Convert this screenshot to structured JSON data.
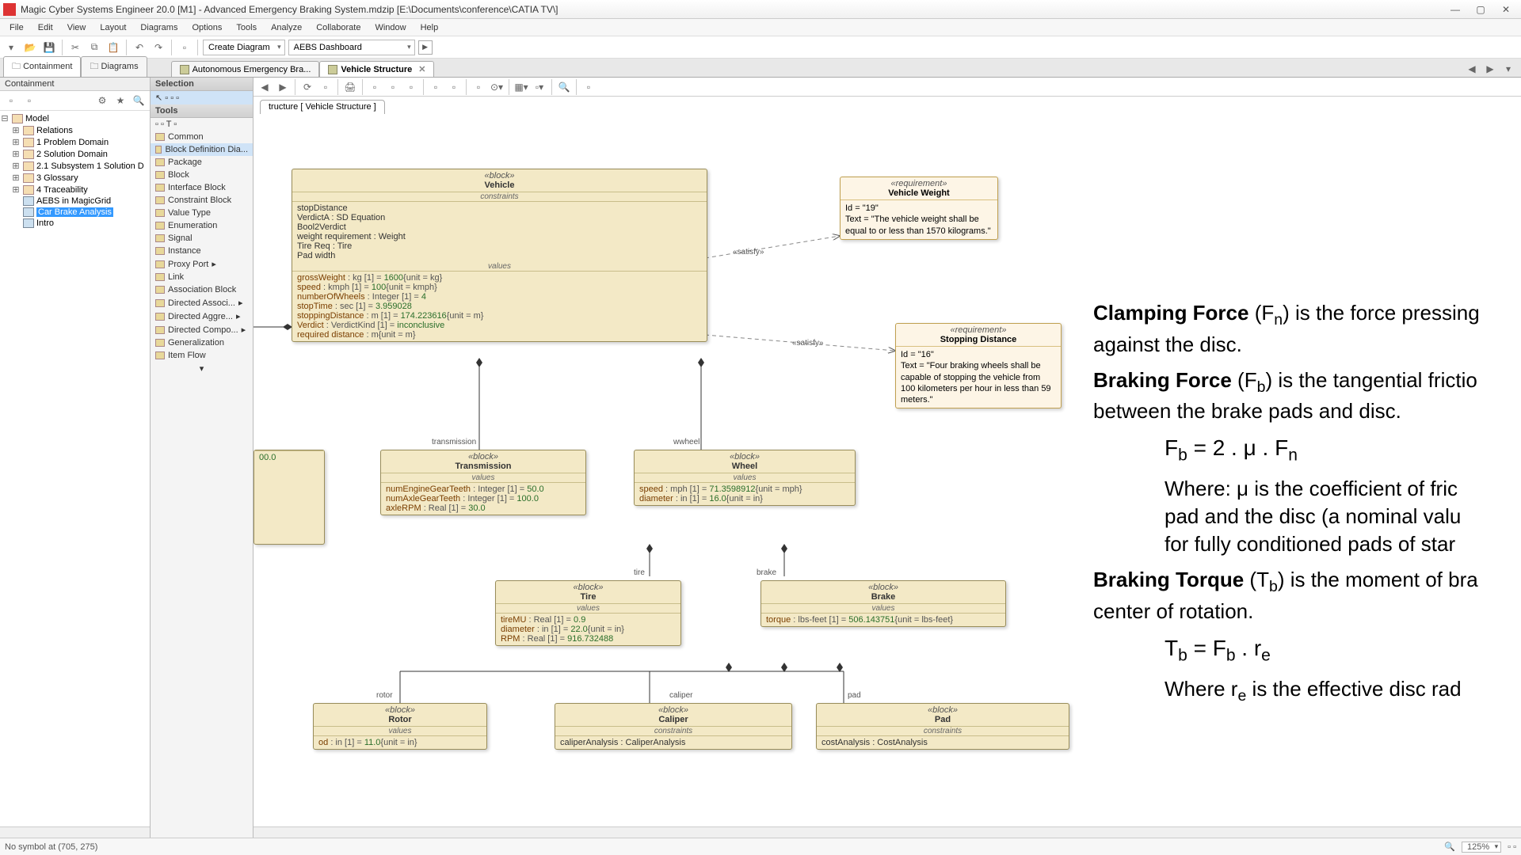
{
  "window": {
    "title": "Magic Cyber Systems Engineer 20.0 [M1] - Advanced Emergency Braking System.mdzip [E:\\Documents\\conference\\CATIA TV\\]",
    "minimize": "—",
    "maximize": "▢",
    "close": "✕"
  },
  "menu": [
    "File",
    "Edit",
    "View",
    "Layout",
    "Diagrams",
    "Options",
    "Tools",
    "Analyze",
    "Collaborate",
    "Window",
    "Help"
  ],
  "toolbar": {
    "create_diagram": "Create Diagram",
    "dashboard": "AEBS Dashboard"
  },
  "side_tabs": {
    "containment": "Containment",
    "diagrams": "Diagrams"
  },
  "doctabs": {
    "tab1": "Autonomous Emergency Bra...",
    "tab2": "Vehicle Structure"
  },
  "containment_panel": {
    "title": "Containment",
    "tree": {
      "root": "Model",
      "relations": "Relations",
      "problem": "1 Problem Domain",
      "solution": "2 Solution Domain",
      "subsystem": "2.1 Subsystem 1 Solution D",
      "glossary": "3 Glossary",
      "traceability": "4 Traceability",
      "aebs": "AEBS in MagicGrid",
      "car_brake": "Car Brake Analysis",
      "intro": "Intro"
    }
  },
  "palette": {
    "selection_head": "Selection",
    "tools_head": "Tools",
    "common": "Common",
    "bdd": "Block Definition Dia...",
    "package": "Package",
    "block": "Block",
    "interface": "Interface Block",
    "constraint": "Constraint Block",
    "valuetype": "Value Type",
    "enumeration": "Enumeration",
    "signal": "Signal",
    "instance": "Instance",
    "proxyport": "Proxy Port",
    "link": "Link",
    "assocblock": "Association Block",
    "dirassoc": "Directed Associ...",
    "diraggre": "Directed Aggre...",
    "dircompo": "Directed Compo...",
    "generalization": "Generalization",
    "itemflow": "Item Flow"
  },
  "breadcrumb": "tructure [ Vehicle Structure ]",
  "diagram": {
    "vehicle": {
      "stereo": "«block»",
      "name": "Vehicle",
      "sec_constraints": "constraints",
      "c1": "stopDistance",
      "c2": "VerdictA : SD Equation",
      "c3": "Bool2Verdict",
      "c4": "weight requirement : Weight",
      "c5": "Tire Req : Tire",
      "c6": "Pad width",
      "sec_values": "values",
      "v1_k": "grossWeight",
      "v1_t": ": kg [1] = ",
      "v1_v": "1600",
      "v1_u": "{unit = kg}",
      "v2_k": "speed",
      "v2_t": ": kmph [1] = ",
      "v2_v": "100",
      "v2_u": "{unit = kmph}",
      "v3_k": "numberOfWheels",
      "v3_t": ": Integer [1] = ",
      "v3_v": "4",
      "v4_k": "stopTime",
      "v4_t": ": sec [1] = ",
      "v4_v": "3.959028",
      "v5_k": "stoppingDistance",
      "v5_t": ": m [1] = ",
      "v5_v": "174.223616",
      "v5_u": "{unit = m}",
      "v6_k": "Verdict",
      "v6_t": ": VerdictKind [1] = ",
      "v6_v": "inconclusive",
      "v7_k": "required distance",
      "v7_t": ": m{unit = m}"
    },
    "req_weight": {
      "stereo": "«requirement»",
      "name": "Vehicle Weight",
      "id": "Id = \"19\"",
      "text": "Text = \"The vehicle weight shall be equal to or less than 1570 kilograms.\""
    },
    "req_stop": {
      "stereo": "«requirement»",
      "name": "Stopping Distance",
      "id": "Id = \"16\"",
      "text": "Text = \"Four braking wheels shall be capable of stopping the vehicle from 100 kilometers per hour in less than 59 meters.\""
    },
    "transmission": {
      "stereo": "«block»",
      "name": "Transmission",
      "sec": "values",
      "l1_k": "numEngineGearTeeth",
      "l1_t": ": Integer [1] = ",
      "l1_v": "50.0",
      "l2_k": "numAxleGearTeeth",
      "l2_t": ": Integer [1] = ",
      "l2_v": "100.0",
      "l3_k": "axleRPM",
      "l3_t": ": Real [1] = ",
      "l3_v": "30.0"
    },
    "wheel": {
      "stereo": "«block»",
      "name": "Wheel",
      "sec": "values",
      "l1_k": "speed",
      "l1_t": ": mph [1] = ",
      "l1_v": "71.3598912",
      "l1_u": "{unit = mph}",
      "l2_k": "diameter",
      "l2_t": ": in [1] = ",
      "l2_v": "16.0",
      "l2_u": "{unit = in}"
    },
    "tire": {
      "stereo": "«block»",
      "name": "Tire",
      "sec": "values",
      "l1_k": "tireMU",
      "l1_t": ": Real [1] = ",
      "l1_v": "0.9",
      "l2_k": "diameter",
      "l2_t": ": in [1] = ",
      "l2_v": "22.0",
      "l2_u": "{unit = in}",
      "l3_k": "RPM",
      "l3_t": ": Real [1] = ",
      "l3_v": "916.732488"
    },
    "brake": {
      "stereo": "«block»",
      "name": "Brake",
      "sec": "values",
      "l1_k": "torque",
      "l1_t": ": lbs-feet [1] = ",
      "l1_v": "506.143751",
      "l1_u": "{unit = lbs-feet}"
    },
    "rotor": {
      "stereo": "«block»",
      "name": "Rotor",
      "sec": "values",
      "l1_k": "od",
      "l1_t": ": in [1] = ",
      "l1_v": "11.0",
      "l1_u": "{unit = in}"
    },
    "caliper": {
      "stereo": "«block»",
      "name": "Caliper",
      "sec": "constraints",
      "l1": "caliperAnalysis : CaliperAnalysis"
    },
    "pad": {
      "stereo": "«block»",
      "name": "Pad",
      "sec": "constraints",
      "l1": "costAnalysis : CostAnalysis"
    },
    "partial": {
      "val": "00.0"
    },
    "labels": {
      "satisfy1": "«satisfy»",
      "satisfy2": "«satisfy»",
      "transmission": "transmission",
      "wwheel": "wwheel",
      "tire": "tire",
      "brake": "brake",
      "rotor": "rotor",
      "caliper": "caliper",
      "pad": "pad"
    }
  },
  "annotation": {
    "p1a": "Clamping Force",
    "p1b": " (F",
    "p1c": ") is the force pressing",
    "p1d": "against the disc.",
    "p2a": "Braking Force",
    "p2b": " (F",
    "p2c": ") is the tangential frictio",
    "p2d": "between the brake pads and disc.",
    "f1": "F",
    "f1b": " = 2 . μ . F",
    "p3": "Where: μ is the coefficient of fric",
    "p3b": "pad and the disc (a nominal valu",
    "p3c": "for fully conditioned pads of star",
    "p4a": "Braking Torque",
    "p4b": " (T",
    "p4c": ") is the moment of bra",
    "p4d": "center of rotation.",
    "f2": "T",
    "f2b": " = F",
    "f2c": " . r",
    "p5": "Where r",
    "p5b": " is the effective disc rad"
  },
  "status": {
    "left": "No symbol at (705, 275)",
    "zoom": "125%"
  }
}
